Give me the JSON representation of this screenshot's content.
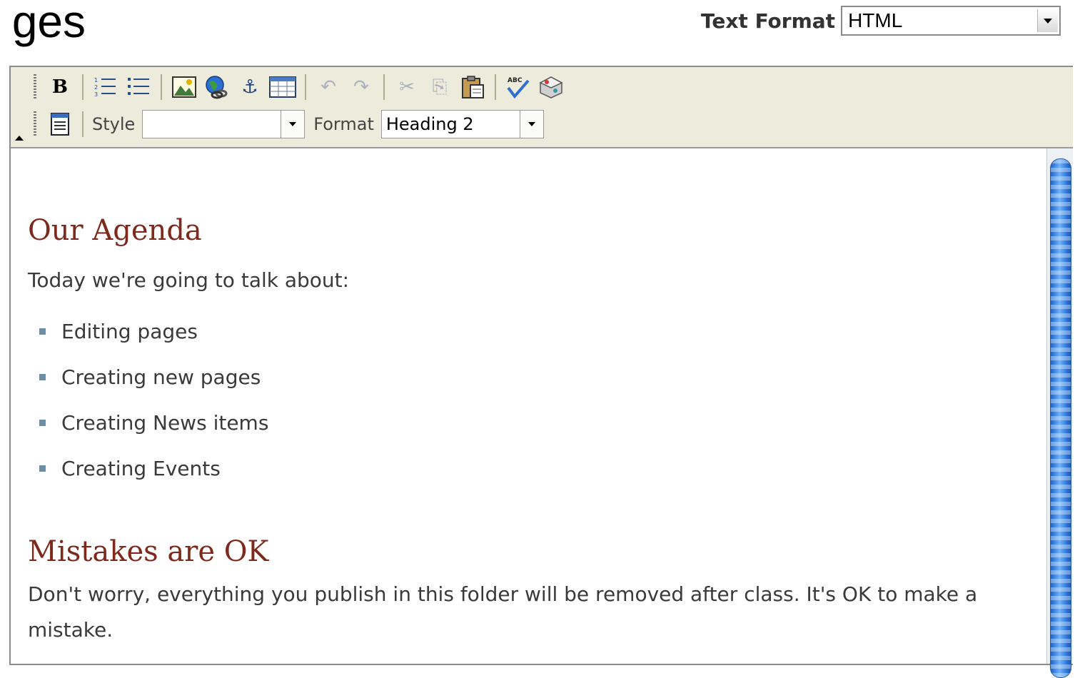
{
  "page": {
    "heading_fragment": "ges"
  },
  "text_format": {
    "label": "Text Format",
    "value": "HTML"
  },
  "toolbar": {
    "row1": [
      {
        "name": "bold-button",
        "glyph": "B",
        "disabled": false
      },
      {
        "name": "numbered-list-button",
        "glyph": "☰",
        "disabled": false
      },
      {
        "name": "bulleted-list-button",
        "glyph": "☰",
        "disabled": false
      },
      {
        "name": "insert-image-button",
        "glyph": "▨",
        "disabled": false
      },
      {
        "name": "insert-link-button",
        "glyph": "🌐",
        "disabled": false
      },
      {
        "name": "anchor-button",
        "glyph": "⚓",
        "disabled": false
      },
      {
        "name": "insert-table-button",
        "glyph": "▦",
        "disabled": false
      },
      {
        "name": "undo-button",
        "glyph": "↶",
        "disabled": true
      },
      {
        "name": "redo-button",
        "glyph": "↷",
        "disabled": true
      },
      {
        "name": "cut-button",
        "glyph": "✂",
        "disabled": true
      },
      {
        "name": "copy-button",
        "glyph": "⎘",
        "disabled": true
      },
      {
        "name": "paste-button",
        "glyph": "📋",
        "disabled": false
      },
      {
        "name": "spellcheck-button",
        "glyph": "✔",
        "disabled": false
      },
      {
        "name": "plugin-button",
        "glyph": "◈",
        "disabled": false
      }
    ],
    "row2": {
      "source_glyph": "🗎",
      "style_label": "Style",
      "style_value": "",
      "format_label": "Format",
      "format_value": "Heading 2"
    }
  },
  "content": {
    "heading1": "Our Agenda",
    "intro": "Today we're going to talk about:",
    "items": [
      "Editing pages",
      "Creating new pages",
      "Creating News items",
      "Creating Events"
    ],
    "heading2": "Mistakes are OK",
    "paragraph": "Don't worry, everything you publish in this folder will be removed after class. It's OK to make a mistake."
  },
  "colors": {
    "heading": "#7d2a1d",
    "toolbar_bg": "#ecebdc",
    "bullet": "#6b8fa7",
    "scroll_thumb": "#2f77d8"
  }
}
